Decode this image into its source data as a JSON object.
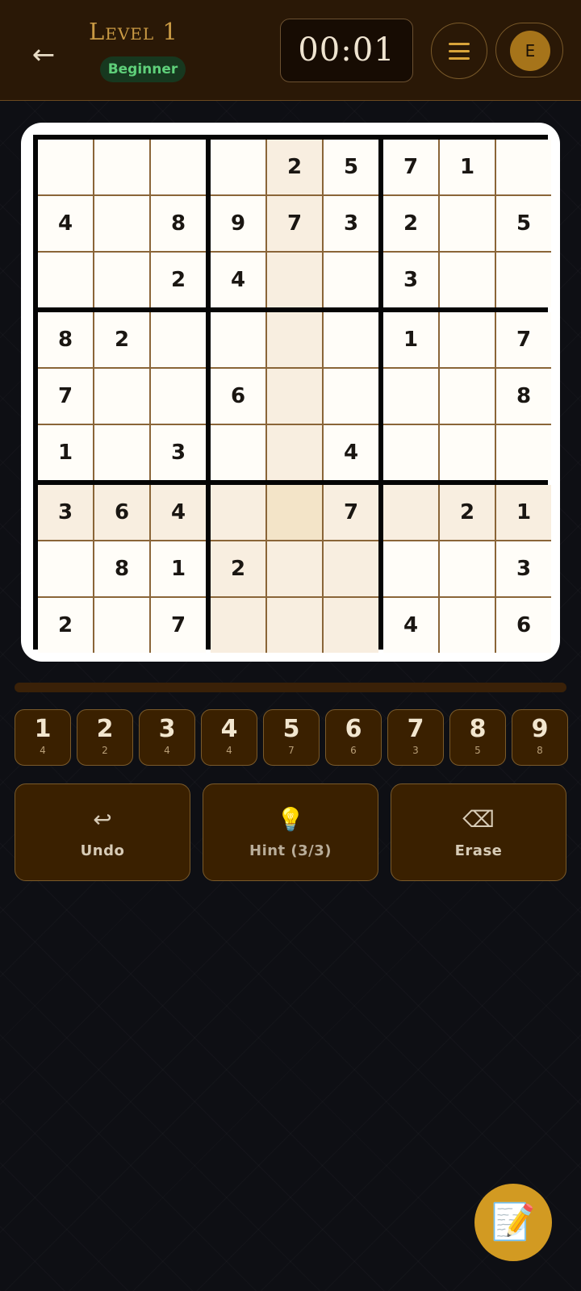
{
  "header": {
    "back_icon": "←",
    "level_title": "Level 1",
    "difficulty": "Beginner",
    "timer": "00:01",
    "avatar_initial": "E"
  },
  "board": {
    "grid": [
      [
        "",
        "",
        "",
        "",
        "2",
        "5",
        "7",
        "1",
        ""
      ],
      [
        "4",
        "",
        "8",
        "9",
        "7",
        "3",
        "2",
        "",
        "5"
      ],
      [
        "",
        "",
        "2",
        "4",
        "",
        "",
        "3",
        "",
        ""
      ],
      [
        "8",
        "2",
        "",
        "",
        "",
        "",
        "1",
        "",
        "7"
      ],
      [
        "7",
        "",
        "",
        "6",
        "",
        "",
        "",
        "",
        "8"
      ],
      [
        "1",
        "",
        "3",
        "",
        "",
        "4",
        "",
        "",
        ""
      ],
      [
        "3",
        "6",
        "4",
        "",
        "",
        "7",
        "",
        "2",
        "1"
      ],
      [
        "",
        "8",
        "1",
        "2",
        "",
        "",
        "",
        "",
        "3"
      ],
      [
        "2",
        "",
        "7",
        "",
        "",
        "",
        "4",
        "",
        "6"
      ]
    ],
    "selected_cell": {
      "row": 6,
      "col": 4
    }
  },
  "progress": {
    "fraction": 0.0
  },
  "number_pad": [
    {
      "digit": "1",
      "count": "4"
    },
    {
      "digit": "2",
      "count": "2"
    },
    {
      "digit": "3",
      "count": "4"
    },
    {
      "digit": "4",
      "count": "4"
    },
    {
      "digit": "5",
      "count": "7"
    },
    {
      "digit": "6",
      "count": "6"
    },
    {
      "digit": "7",
      "count": "3"
    },
    {
      "digit": "8",
      "count": "5"
    },
    {
      "digit": "9",
      "count": "8"
    }
  ],
  "actions": {
    "undo": {
      "icon": "↩",
      "label": "Undo"
    },
    "hint": {
      "icon": "💡",
      "label": "Hint (3/3)"
    },
    "erase": {
      "icon": "⌫",
      "label": "Erase"
    }
  },
  "fab": {
    "icon": "📝"
  },
  "colors": {
    "header_bg": "#2a1806",
    "accent_gold": "#d29a22",
    "cell_bg": "#fffdf8",
    "highlight_bg": "#f8eee0",
    "selected_bg": "#f3e4c8",
    "inner_line": "#8a6538",
    "box_line": "#050505"
  }
}
